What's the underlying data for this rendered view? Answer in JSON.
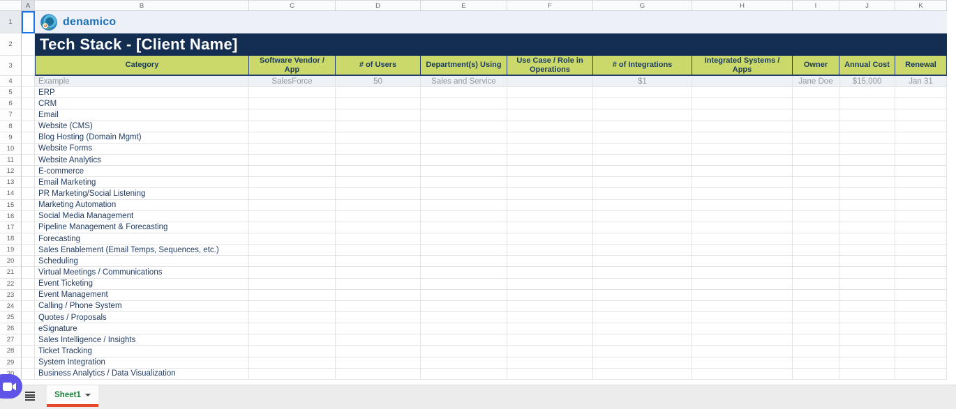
{
  "spreadsheet": {
    "column_letters": [
      "A",
      "B",
      "C",
      "D",
      "E",
      "F",
      "G",
      "H",
      "I",
      "J",
      "K"
    ],
    "row_count": 30,
    "selected_cell": "A1",
    "logo_text": "denamico",
    "title": "Tech Stack - [Client Name]",
    "headers": [
      "Category",
      "Software Vendor / App",
      "# of Users",
      "Department(s) Using",
      "Use Case / Role in Operations",
      "# of Integrations",
      "Integrated Systems / Apps",
      "Owner",
      "Annual Cost",
      "Renewal"
    ],
    "example_row": [
      "Example",
      "SalesForce",
      "50",
      "Sales and Service",
      "",
      "$1",
      "",
      "Jane Doe",
      "$15,000",
      "Jan 31"
    ],
    "categories": [
      "ERP",
      "CRM",
      "Email",
      "Website (CMS)",
      "Blog Hosting (Domain Mgmt)",
      "Website Forms",
      "Website Analytics",
      "E-commerce",
      "Email Marketing",
      "PR Marketing/Social Listening",
      "Marketing Automation",
      "Social Media Management",
      "Pipeline Management & Forecasting",
      "Forecasting",
      "Sales Enablement (Email Temps, Sequences, etc.)",
      "Scheduling",
      "Virtual Meetings / Communications",
      "Event Ticketing",
      "Event Management",
      "Calling / Phone System",
      "Quotes / Proposals",
      "eSignature",
      "Sales Intelligence / Insights",
      "Ticket Tracking",
      "System Integration",
      "Business Analytics / Data Visualization"
    ]
  },
  "sheet_bar": {
    "active_tab": "Sheet1",
    "meet_button_icon": "video-camera-icon",
    "all_sheets_icon": "all-sheets-menu-icon",
    "tab_dropdown_icon": "chevron-down-icon"
  },
  "colors": {
    "banner_navy": "#132e51",
    "header_green": "#cbd96a",
    "header_border_navy": "#23406b",
    "category_text_navy": "#223c63",
    "example_fill": "#eef1f6",
    "accent_orange": "#e8472c",
    "tab_green": "#188038",
    "selection_blue": "#1a73e8",
    "logo_blue": "#1b70b5",
    "meet_purple": "#5e55e8"
  }
}
